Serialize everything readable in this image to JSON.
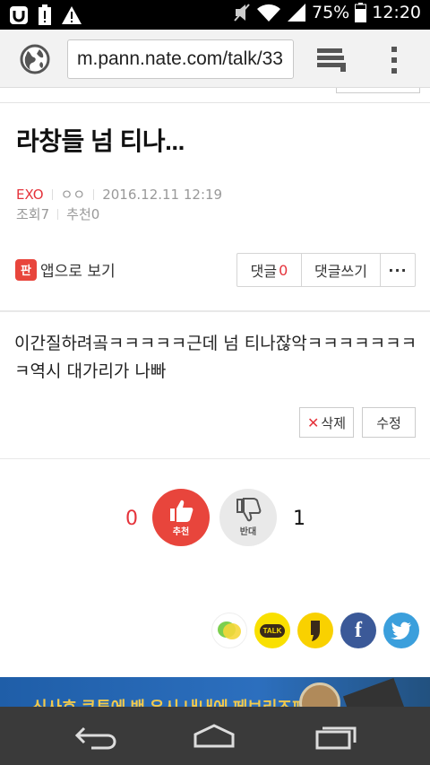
{
  "status_bar": {
    "battery_percent": "75%",
    "time": "12:20",
    "icons": [
      "app-u-icon",
      "battery-alert-icon",
      "warning-icon",
      "mute-icon",
      "wifi-icon",
      "signal-icon",
      "battery-icon"
    ]
  },
  "browser": {
    "url": "m.pann.nate.com/talk/33",
    "icons": [
      "globe-icon",
      "tabs-icon",
      "overflow-menu-icon"
    ]
  },
  "post": {
    "title": "라창들 넘 티나...",
    "category": "EXO",
    "author": "ㅇㅇ",
    "date": "2016.12.11 12:19",
    "views_label": "조회",
    "views": "7",
    "recommend_label": "추천",
    "recommend": "0",
    "app_view_label": "앱으로 보기",
    "app_logo_text": "판",
    "comment_label": "댓글",
    "comment_count": "0",
    "write_comment_label": "댓글쓰기",
    "more_label": "···",
    "body": "이간질하려곸ㅋㅋㅋㅋㅋ근데 넘 티나잖악ㅋㅋㅋㅋㅋㅋㅋㅋ역시 대가리가 나빠",
    "delete_label": "삭제",
    "edit_label": "수정"
  },
  "votes": {
    "like_count": "0",
    "like_label": "추천",
    "dislike_label": "반대",
    "dislike_count": "1"
  },
  "share": {
    "talk_label": "TALK",
    "facebook_glyph": "f",
    "colors": {
      "kakaostory": "#f9d100",
      "kakaotalk": "#f9e000",
      "facebook": "#3b5998",
      "twitter": "#3b9fdc"
    }
  },
  "ad": {
    "text": "신사호 쿠투에 밴 유시 내내에 페브리즈패"
  },
  "accent": "#e5333b"
}
